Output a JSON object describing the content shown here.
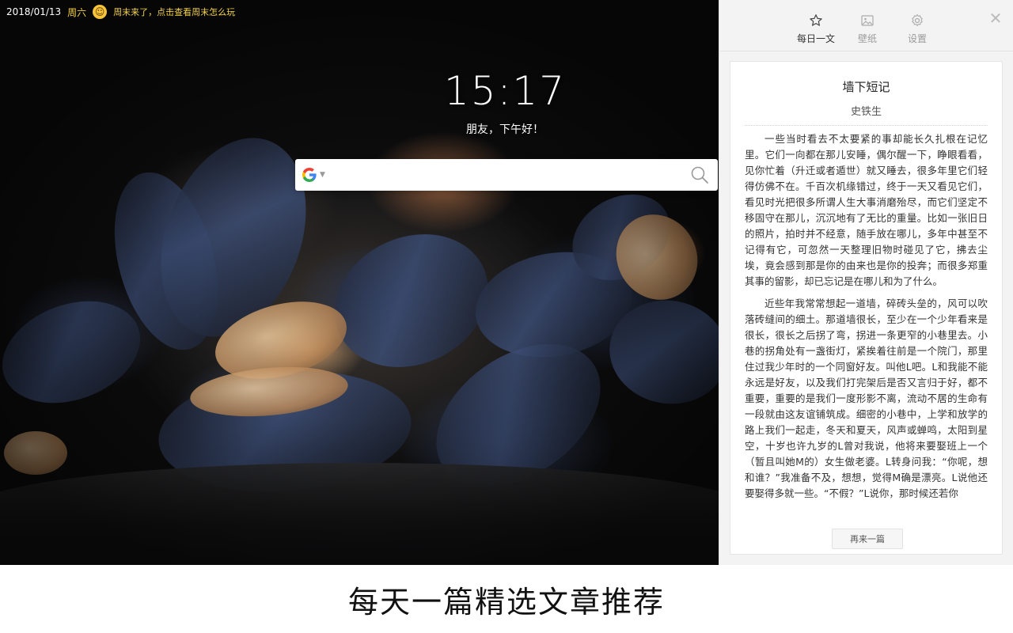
{
  "topbar": {
    "date": "2018/01/13",
    "weekday": "周六",
    "tip": "周末来了，点击查看周末怎么玩"
  },
  "clock": {
    "time": "15:17",
    "greeting": "朋友，下午好！"
  },
  "search": {
    "engine_icon": "google-logo-icon",
    "placeholder": "",
    "value": ""
  },
  "panel": {
    "tabs": [
      {
        "label": "每日一文",
        "icon": "star-icon",
        "active": true
      },
      {
        "label": "壁纸",
        "icon": "image-icon",
        "active": false
      },
      {
        "label": "设置",
        "icon": "gear-icon",
        "active": false
      }
    ],
    "article": {
      "title": "墙下短记",
      "author": "史铁生",
      "paragraphs": [
        "一些当时看去不太要紧的事却能长久扎根在记忆里。它们一向都在那儿安睡，偶尔醒一下，睁眼看看，见你忙着（升迁或者遁世）就又睡去，很多年里它们轻得仿佛不在。千百次机缘错过，终于一天又看见它们，看见时光把很多所谓人生大事消磨殆尽，而它们坚定不移固守在那儿，沉沉地有了无比的重量。比如一张旧日的照片，拍时并不经意，随手放在哪儿，多年中甚至不记得有它，可忽然一天整理旧物时碰见了它，拂去尘埃，竟会感到那是你的由来也是你的投奔；而很多郑重其事的留影，却已忘记是在哪儿和为了什么。",
        "近些年我常常想起一道墙，碎砖头垒的，风可以吹落砖缝间的细土。那道墙很长，至少在一个少年看来是很长，很长之后拐了弯，拐进一条更窄的小巷里去。小巷的拐角处有一盏街灯，紧挨着往前是一个院门，那里住过我少年时的一个同窗好友。叫他L吧。L和我能不能永远是好友，以及我们打完架后是否又言归于好，都不重要，重要的是我们一度形影不离，流动不居的生命有一段就由这友谊铺筑成。细密的小巷中，上学和放学的路上我们一起走，冬天和夏天，风声或蝉鸣，太阳到星空，十岁也许九岁的L曾对我说，他将来要娶班上一个（暂且叫她M的）女生做老婆。L转身问我：“你呢，想和谁？”我准备不及，想想，觉得M确是漂亮。L说他还要娶得多就一些。“不假？”L说你，那时候还若你"
      ],
      "another_label": "再来一篇"
    },
    "close_icon": "close-icon"
  },
  "caption": "每天一篇精选文章推荐",
  "colors": {
    "accent_yellow": "#f4d24a",
    "panel_bg": "#f3f3f3"
  }
}
